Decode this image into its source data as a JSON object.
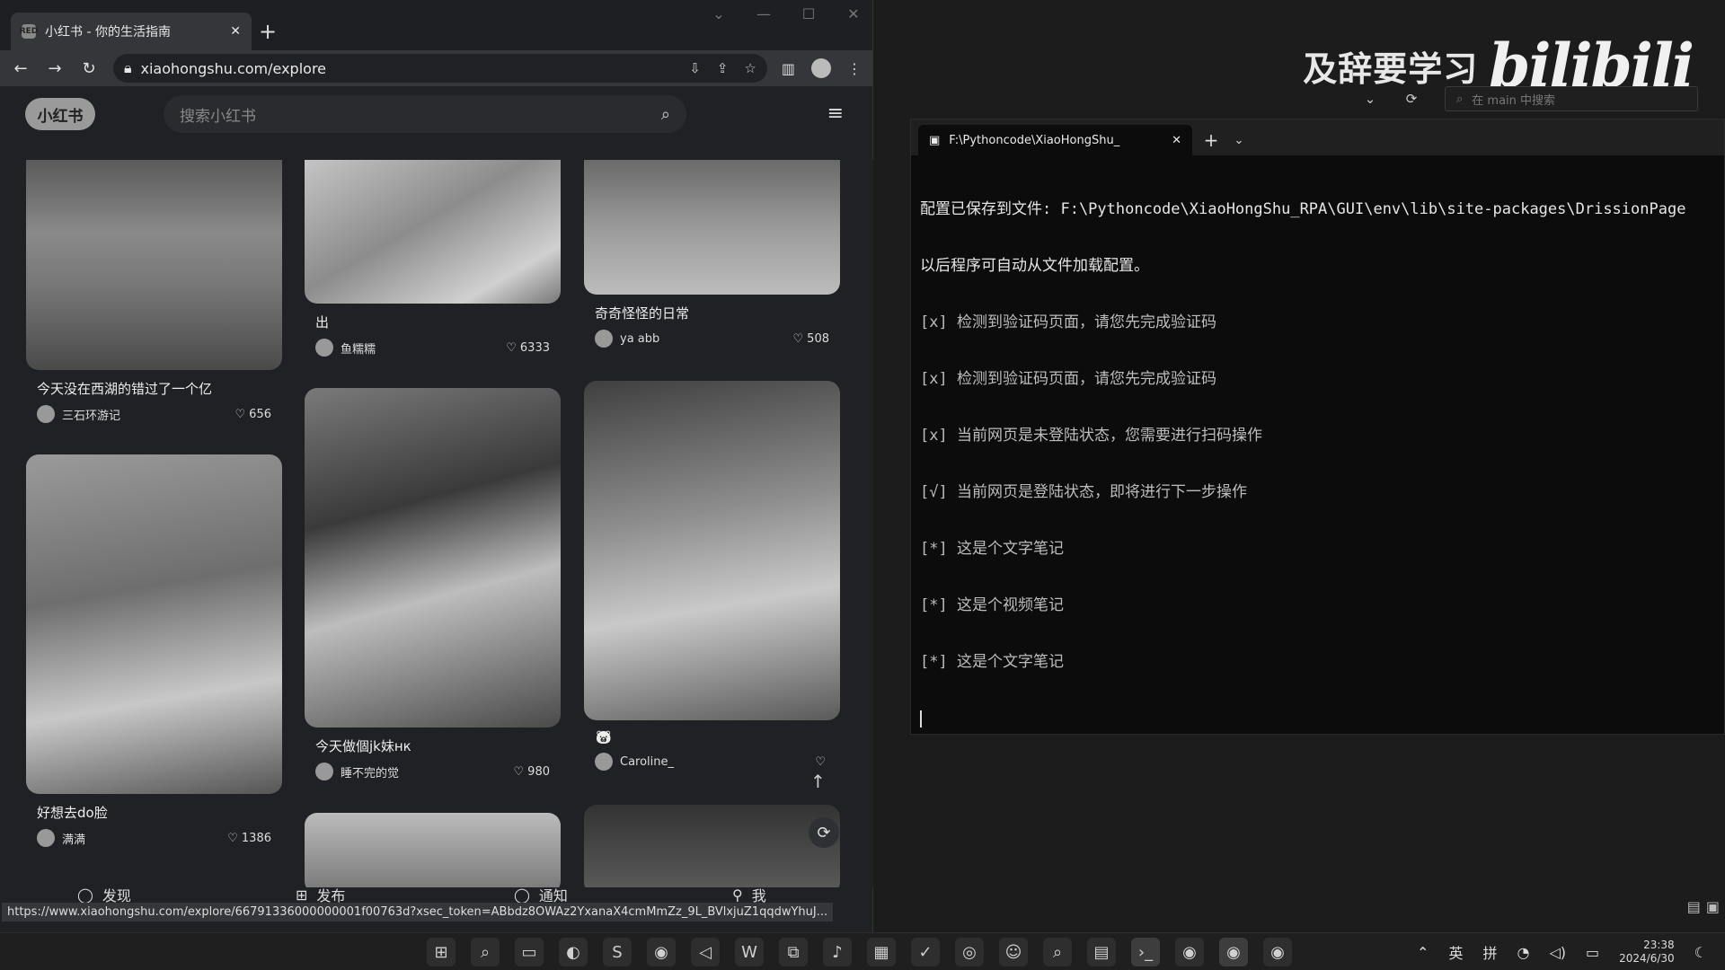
{
  "watermark": {
    "text": "及辞要学习",
    "logo": "bilibili"
  },
  "vscode": {
    "search_placeholder": "在 main 中搜索"
  },
  "terminal": {
    "tab_title": "F:\\Pythoncode\\XiaoHongShu_",
    "lines": [
      "配置已保存到文件: F:\\Pythoncode\\XiaoHongShu_RPA\\GUI\\env\\lib\\site-packages\\DrissionPage",
      "以后程序可自动从文件加载配置。",
      "[x] 检测到验证码页面，请您先完成验证码",
      "[x] 检测到验证码页面，请您先完成验证码",
      "[x] 当前网页是未登陆状态，您需要进行扫码操作",
      "[√] 当前网页是登陆状态，即将进行下一步操作",
      "[*] 这是个文字笔记",
      "[*] 这是个视频笔记",
      "[*] 这是个文字笔记"
    ]
  },
  "browser": {
    "tab_title": "小红书 - 你的生活指南",
    "favicon_text": "RED",
    "url": "xiaohongshu.com/explore",
    "status_url": "https://www.xiaohongshu.com/explore/66791336000000001f00763d?xsec_token=ABbdz8OWAz2YxanaX4cmMmZz_9L_BVlxjuZ1qqdwYhuJ..."
  },
  "xhs": {
    "logo": "小红书",
    "search_placeholder": "搜索小红书",
    "cards": [
      {
        "title": "今天没在西湖的错过了一个亿",
        "author": "三石环游记",
        "likes": "656"
      },
      {
        "title": "出",
        "author": "鱼糯糯",
        "likes": "6333"
      },
      {
        "title": "奇奇怪怪的日常",
        "author": "ya abb",
        "likes": "508"
      },
      {
        "title": "好想去do脸",
        "author": "满满",
        "likes": "1386"
      },
      {
        "title": "今天做個jk妹нк",
        "author": "睡不完的觉",
        "likes": "980"
      },
      {
        "title": "",
        "author": "Caroline_",
        "likes": ""
      }
    ],
    "nav": [
      {
        "label": "发现"
      },
      {
        "label": "发布"
      },
      {
        "label": "通知"
      },
      {
        "label": "我"
      }
    ]
  },
  "tray": {
    "lang1": "英",
    "lang2": "拼",
    "time": "23:38",
    "date": "2024/6/30"
  },
  "icons": {
    "search": "search-icon",
    "refresh": "refresh-icon",
    "heart": "heart-icon"
  }
}
